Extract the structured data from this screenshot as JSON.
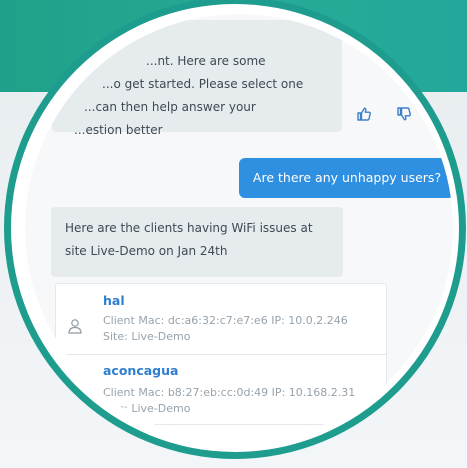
{
  "chat": {
    "bot_intro_lines": [
      "...nt. Here are some",
      "...o get started. Please select one",
      "...can then help answer your",
      "...estion better"
    ],
    "user_message": "Are there any unhappy users?",
    "bot_reply": "Here are the clients having WiFi issues at site Live-Demo on Jan 24th"
  },
  "clients": [
    {
      "name": "hal",
      "detail": "Client Mac: dc:a6:32:c7:e7:e6 IP: 10.0.2.246 Site: Live-Demo",
      "icon": "user-icon"
    },
    {
      "name": "aconcagua",
      "detail": "Client Mac: b8:27:eb:cc:0d:49 IP: 10.168.2.31 Site: Live-Demo",
      "icon": ""
    },
    {
      "name": "",
      "detail": "",
      "icon": ""
    }
  ],
  "feedback": {
    "thumbs_up_icon": "thumbs-up-icon",
    "thumbs_down_icon": "thumbs-down-icon"
  },
  "colors": {
    "brand_teal": "#1fa089",
    "user_bubble": "#2f8fe0",
    "link_blue": "#2f7fd1",
    "bot_bubble": "#e6ebee"
  }
}
